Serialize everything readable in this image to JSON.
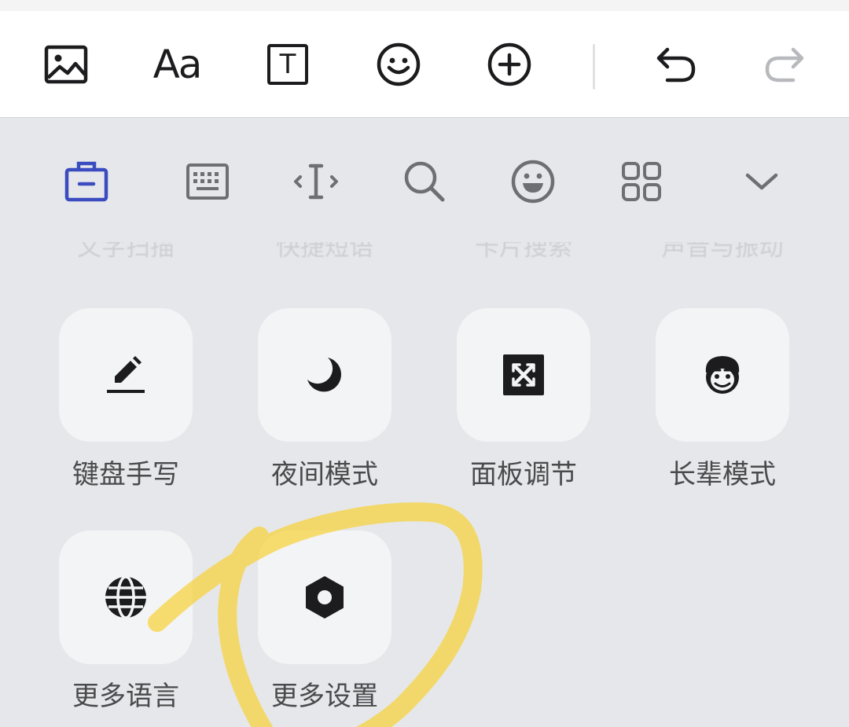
{
  "editor_toolbar": {
    "tools": [
      {
        "name": "image-icon"
      },
      {
        "name": "font-size-icon",
        "glyph": "Aa"
      },
      {
        "name": "text-box-icon",
        "glyph": "T"
      },
      {
        "name": "sticker-icon"
      },
      {
        "name": "add-icon"
      },
      {
        "name": "undo-icon"
      },
      {
        "name": "redo-icon"
      }
    ]
  },
  "keyboard_toolbar": {
    "active_color": "#3b4cc0",
    "items": [
      {
        "name": "toolbox-icon",
        "active": true
      },
      {
        "name": "keyboard-icon"
      },
      {
        "name": "cursor-move-icon"
      },
      {
        "name": "search-icon"
      },
      {
        "name": "emoji-icon"
      },
      {
        "name": "apps-grid-icon"
      },
      {
        "name": "collapse-chevron-icon"
      }
    ]
  },
  "ghost_row": {
    "labels": [
      "文字扫描",
      "快捷短语",
      "卡片搜索",
      "声音与振动"
    ]
  },
  "tools_grid": {
    "items": [
      {
        "label": "键盘手写",
        "icon": "pen-write-icon"
      },
      {
        "label": "夜间模式",
        "icon": "moon-icon"
      },
      {
        "label": "面板调节",
        "icon": "panel-resize-icon"
      },
      {
        "label": "长辈模式",
        "icon": "elder-face-icon"
      },
      {
        "label": "更多语言",
        "icon": "globe-icon"
      },
      {
        "label": "更多设置",
        "icon": "settings-hexagon-icon"
      }
    ]
  },
  "annotation": {
    "highlight_color": "#f6d23a"
  }
}
